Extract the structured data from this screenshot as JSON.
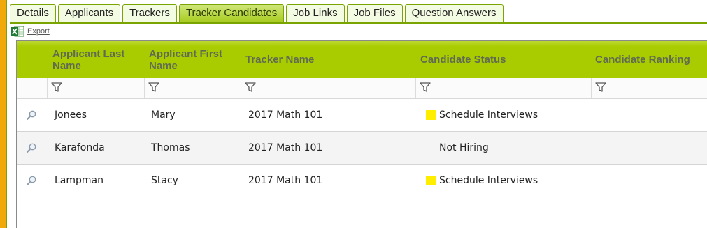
{
  "tabs": [
    {
      "label": "Details",
      "active": false
    },
    {
      "label": "Applicants",
      "active": false
    },
    {
      "label": "Trackers",
      "active": false
    },
    {
      "label": "Tracker Candidates",
      "active": true
    },
    {
      "label": "Job Links",
      "active": false
    },
    {
      "label": "Job Files",
      "active": false
    },
    {
      "label": "Question Answers",
      "active": false
    }
  ],
  "export": {
    "label": "Export",
    "icon": "excel-icon"
  },
  "grid": {
    "columns": [
      {
        "key": "last_name",
        "label": "Applicant Last Name"
      },
      {
        "key": "first_name",
        "label": "Applicant First Name"
      },
      {
        "key": "tracker",
        "label": "Tracker Name"
      },
      {
        "key": "status",
        "label": "Candidate Status"
      },
      {
        "key": "ranking",
        "label": "Candidate Ranking"
      }
    ],
    "rows": [
      {
        "last_name": "Jonees",
        "first_name": "Mary",
        "tracker": "2017 Math 101",
        "status": "Schedule Interviews",
        "status_color": "#ffee00"
      },
      {
        "last_name": "Karafonda",
        "first_name": "Thomas",
        "tracker": "2017 Math 101",
        "status": "Not Hiring",
        "status_color": ""
      },
      {
        "last_name": "Lampman",
        "first_name": "Stacy",
        "tracker": "2017 Math 101",
        "status": "Schedule Interviews",
        "status_color": "#ffee00"
      }
    ]
  },
  "colors": {
    "header": "#a9cc00",
    "tab_border": "#7aa400",
    "accent_bar": "#f0a80a",
    "status_yellow": "#ffee00"
  }
}
